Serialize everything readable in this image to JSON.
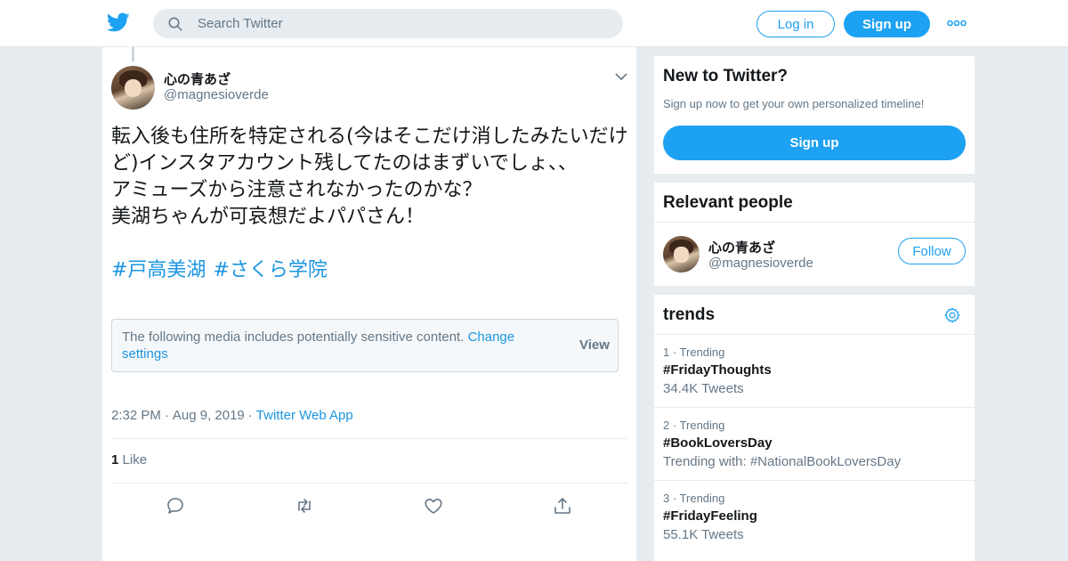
{
  "header": {
    "search_placeholder": "Search Twitter",
    "login_label": "Log in",
    "signup_label": "Sign up"
  },
  "tweet": {
    "display_name": "心の青あざ",
    "handle": "@magnesioverde",
    "text": "転入後も住所を特定される(今はそこだけ消したみたいだけど)インスタアカウント残してたのはまずいでしょ、、\nアミューズから注意されなかったのかな？\n美湖ちゃんが可哀想だよパパさん！",
    "hashtags": [
      "#戸高美湖",
      "#さくら学院"
    ],
    "sensitive_notice": "The following media includes potentially sensitive content.",
    "sensitive_link": "Change settings",
    "view_label": "View",
    "time": "2:32 PM",
    "date": "Aug 9, 2019",
    "source": "Twitter Web App",
    "like_count": "1",
    "like_label": "Like"
  },
  "sidebar": {
    "new_to_twitter": {
      "title": "New to Twitter?",
      "subtitle": "Sign up now to get your own personalized timeline!",
      "button": "Sign up"
    },
    "relevant_people": {
      "title": "Relevant people",
      "name": "心の青あざ",
      "handle": "@magnesioverde",
      "follow_label": "Follow"
    },
    "trends": {
      "title": "trends",
      "items": [
        {
          "rank": "1 · Trending",
          "tag": "#FridayThoughts",
          "sub": "34.4K Tweets"
        },
        {
          "rank": "2 · Trending",
          "tag": "#BookLoversDay",
          "sub": "Trending with: #NationalBookLoversDay"
        },
        {
          "rank": "3 · Trending",
          "tag": "#FridayFeeling",
          "sub": "55.1K Tweets"
        }
      ]
    }
  },
  "colors": {
    "brand_blue": "#1da1f2",
    "link_blue": "#1b95e0",
    "background": "#e6ecf0"
  },
  "icons": [
    "twitter-bird-icon",
    "search-icon",
    "more-icon",
    "chevron-down-icon",
    "reply-icon",
    "retweet-icon",
    "like-icon",
    "share-icon",
    "gear-icon"
  ]
}
